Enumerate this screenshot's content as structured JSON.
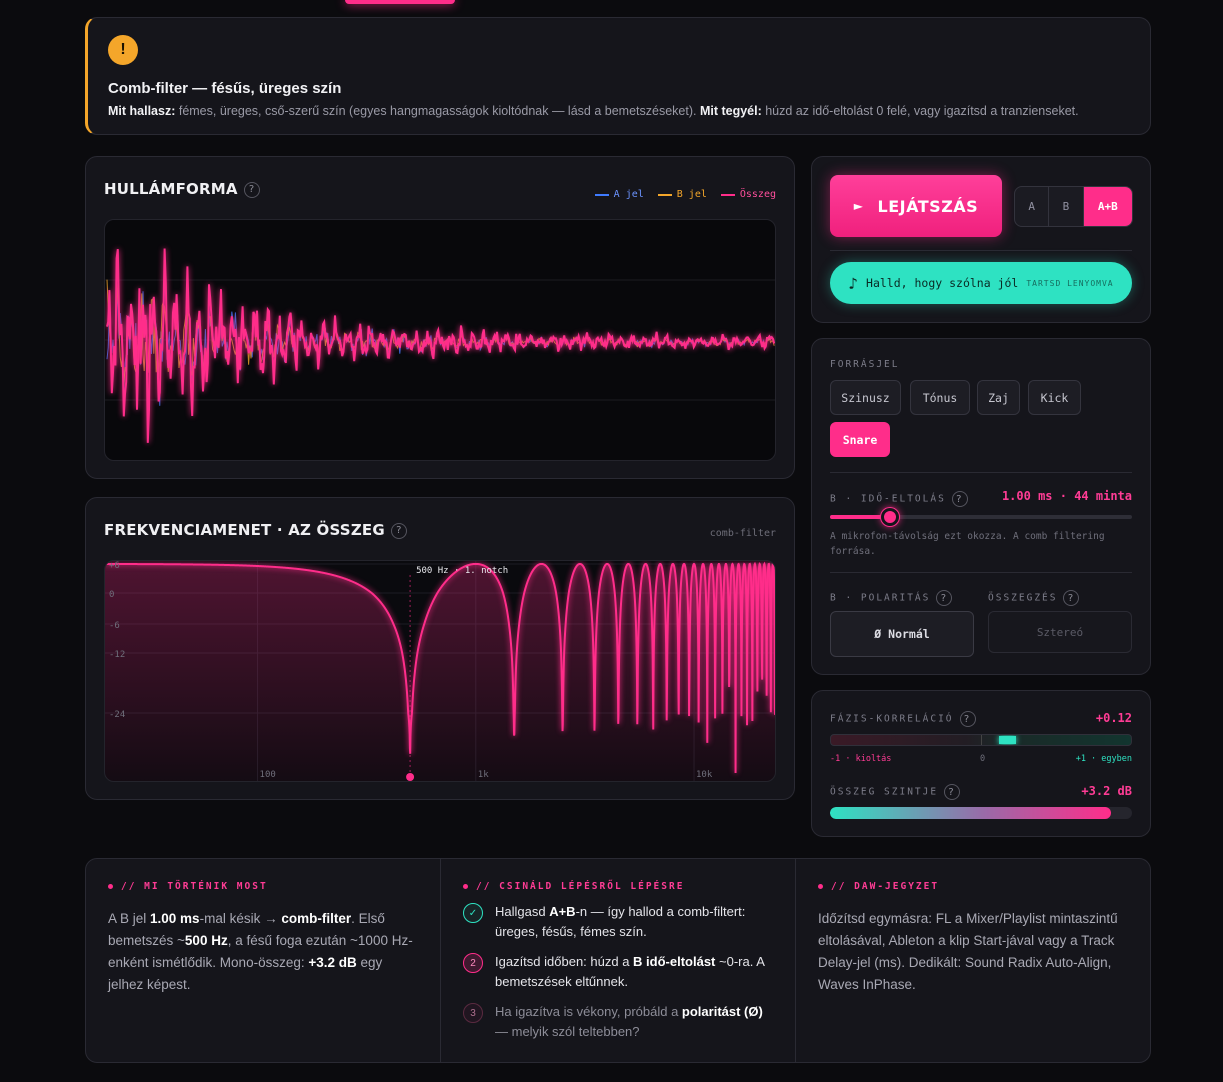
{
  "banner": {
    "icon": "warning-icon",
    "title": "Comb-filter — fésűs, üreges szín",
    "hear_label": "Mit hallasz:",
    "hear_text": " fémes, üreges, cső-szerű szín (egyes hangmagasságok kioltódnak — lásd a bemetszéseket). ",
    "do_label": "Mit tegyél:",
    "do_text": " húzd az idő-eltolást 0 felé, vagy igazítsd a tranzienseket."
  },
  "waveform": {
    "title": "HULLÁMFORMA",
    "help": "?",
    "legend": [
      {
        "label": "A jel",
        "color": "#3f7bff"
      },
      {
        "label": "B jel",
        "color": "#f4a62a"
      },
      {
        "label": "Összeg",
        "color": "#ff2d8a"
      }
    ]
  },
  "frequency": {
    "title": "FREKVENCIAMENET · AZ ÖSSZEG",
    "help": "?",
    "tag": "comb-filter",
    "notch_label": "500 Hz · 1. notch",
    "y_ticks": [
      "+6",
      "0",
      "-6",
      "-12",
      "-24"
    ],
    "x_ticks": [
      "100",
      "1k",
      "10k"
    ],
    "first_notch_hz": 500,
    "delay_ms": 1.0
  },
  "player": {
    "play_icon": "play-icon",
    "play_label": "LEJÁTSZÁS",
    "ab": [
      "A",
      "B",
      "A+B"
    ],
    "ab_selected": "A+B",
    "ref_icon": "♪",
    "ref_label": "Halld, hogy szólna jól",
    "ref_hold": "TARTSD LENYOMVA"
  },
  "source": {
    "label": "FORRÁSJEL",
    "options": [
      "Szinusz",
      "Tónus",
      "Zaj",
      "Kick",
      "Snare"
    ],
    "selected": "Snare",
    "shift_label": "B · IDŐ-ELTOLÁS",
    "shift_value": "1.00 ms · 44 minta",
    "shift_fraction": 0.2,
    "hint": "A mikrofon-távolság ezt okozza. A comb filtering forrása.",
    "polarity_label": "B · POLARITÁS",
    "polarity_value": "Ø Normál",
    "sum_label": "ÖSSZEGZÉS",
    "sum_value": "Sztereó"
  },
  "meters": {
    "corr_label": "FÁZIS-KORRELÁCIÓ",
    "corr_value": "+0.12",
    "corr": 0.12,
    "corr_left": "-1 · kioltás",
    "corr_mid": "0",
    "corr_right": "+1 · egyben",
    "level_label": "ÖSSZEG SZINTJE",
    "level_value": "+3.2 dB",
    "level_fraction": 0.93
  },
  "info": {
    "now_title": "// MI TÖRTÉNIK MOST",
    "now": {
      "t1": "A B jel ",
      "b1": "1.00 ms",
      "t2": "-mal késik → ",
      "b2": "comb-filter",
      "t3": ". Első bemetszés ~",
      "b3": "500 Hz",
      "t4": ", a fésű foga ezután ~1000 Hz-enként ismétlődik. Mono-összeg: ",
      "b4": "+3.2 dB",
      "t5": " egy jelhez képest."
    },
    "steps_title": "// CSINÁLD LÉPÉSRŐL LÉPÉSRE",
    "steps": [
      {
        "num": "✓",
        "a": "Hallgasd ",
        "b": "A+B",
        "c": "-n — így hallod a comb-filtert: üreges, fésűs, fémes szín.",
        "b2": "",
        "d": ""
      },
      {
        "num": "2",
        "a": "Igazítsd időben: húzd a ",
        "b": "B idő-eltolást",
        "c": " ~0-ra. A bemetszések eltűnnek.",
        "b2": "",
        "d": ""
      },
      {
        "num": "3",
        "a": "Ha igazítva is vékony, próbáld a ",
        "b": "polaritást (Ø)",
        "c": " — melyik szól teltebben?",
        "b2": "",
        "d": ""
      }
    ],
    "daw_title": "// DAW-JEGYZET",
    "daw_text": "Időzítsd egymásra: FL a Mixer/Playlist mintaszintű eltolásával, Ableton a klip Start-jával vagy a Track Delay-jel (ms). Dedikált: Sound Radix Auto-Align, Waves InPhase."
  }
}
